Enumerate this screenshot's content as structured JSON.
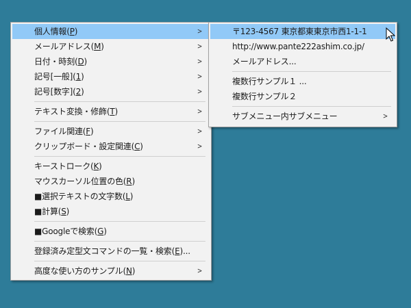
{
  "main_menu": {
    "groups": [
      [
        {
          "label": "個人情報(",
          "acc": "P",
          "tail": ")",
          "submenu": true,
          "highlight": true
        },
        {
          "label": "メールアドレス(",
          "acc": "M",
          "tail": ")",
          "submenu": true
        },
        {
          "label": "日付・時刻(",
          "acc": "D",
          "tail": ")",
          "submenu": true
        },
        {
          "label": "記号[一般](",
          "acc": "1",
          "tail": ")",
          "submenu": true
        },
        {
          "label": "記号[数字](",
          "acc": "2",
          "tail": ")",
          "submenu": true
        }
      ],
      [
        {
          "label": "テキスト変換・修飾(",
          "acc": "T",
          "tail": ")",
          "submenu": true
        }
      ],
      [
        {
          "label": "ファイル関連(",
          "acc": "F",
          "tail": ")",
          "submenu": true
        },
        {
          "label": "クリップボード・設定関連(",
          "acc": "C",
          "tail": ")",
          "submenu": true
        }
      ],
      [
        {
          "label": "キーストローク(",
          "acc": "K",
          "tail": ")",
          "submenu": false
        },
        {
          "label": "マウスカーソル位置の色(",
          "acc": "R",
          "tail": ")",
          "submenu": false
        },
        {
          "label": "■選択テキストの文字数(",
          "acc": "L",
          "tail": ")",
          "submenu": false
        },
        {
          "label": "■計算(",
          "acc": "S",
          "tail": ")",
          "submenu": false
        }
      ],
      [
        {
          "label": "■Googleで検索(",
          "acc": "G",
          "tail": ")",
          "submenu": false
        }
      ],
      [
        {
          "label": "登録済み定型文コマンドの一覧・検索(",
          "acc": "E",
          "tail": ")...",
          "submenu": false
        }
      ],
      [
        {
          "label": "高度な使い方のサンプル(",
          "acc": "N",
          "tail": ")",
          "submenu": true
        }
      ]
    ]
  },
  "sub_menu": {
    "groups": [
      [
        {
          "label": "〒123-4567 東京都東東京市西1-1-1",
          "submenu": false,
          "highlight": true
        },
        {
          "label": "http://www.pante222ashim.co.jp/",
          "submenu": false
        },
        {
          "label": "メールアドレス...",
          "submenu": false
        }
      ],
      [
        {
          "label": "複数行サンプル１ ...",
          "submenu": false
        },
        {
          "label": "複数行サンプル２",
          "submenu": false
        }
      ],
      [
        {
          "label": "サブメニュー内サブメニュー",
          "submenu": true
        }
      ]
    ]
  },
  "icons": {
    "submenu_arrow": ">",
    "cursor": "arrow-cursor"
  },
  "colors": {
    "desktop": "#2e7c99",
    "menu_bg": "#f2f2f2",
    "highlight": "#91c9f7"
  }
}
